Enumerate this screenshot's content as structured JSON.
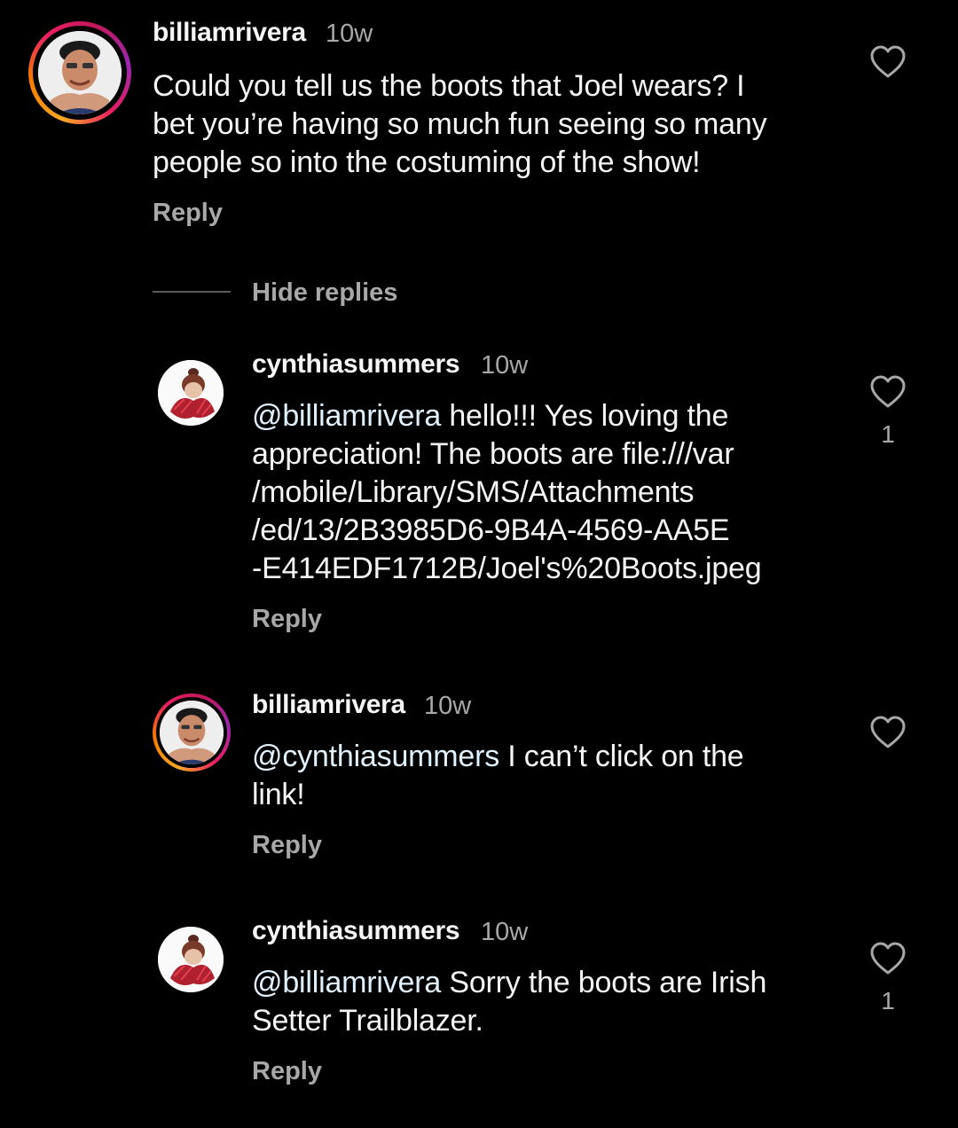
{
  "thread": {
    "hide_replies_label": "Hide replies",
    "reply_label": "Reply",
    "comments": [
      {
        "username": "billiamrivera",
        "time": "10w",
        "text": "Could you tell us the boots that Joel wears?  I\nbet you’re having so much fun seeing so many\npeople so into the costuming of the show!",
        "likes": ""
      },
      {
        "username": "cynthiasummers",
        "time": "10w",
        "mention": "@billiamrivera",
        "text": " hello!!! Yes loving the\nappreciation!  The boots are file:///var\n/mobile/Library/SMS/Attachments\n/ed/13/2B3985D6-9B4A-4569-AA5E\n-E414EDF1712B/Joel's%20Boots.jpeg",
        "likes": "1"
      },
      {
        "username": "billiamrivera",
        "time": "10w",
        "mention": "@cynthiasummers",
        "text": " I can’t click on the\nlink!",
        "likes": ""
      },
      {
        "username": "cynthiasummers",
        "time": "10w",
        "mention": "@billiamrivera",
        "text": "  Sorry the boots are Irish\nSetter Trailblazer.",
        "likes": "1"
      }
    ]
  },
  "colors": {
    "background": "#000000",
    "primary_text": "#f5f5f5",
    "secondary_text": "#a8a8a8",
    "mention": "#e0f1ff",
    "story_ring": [
      "#f9a825",
      "#e91e63",
      "#9c27b0"
    ]
  },
  "icons": {
    "like": "heart-outline-icon"
  }
}
